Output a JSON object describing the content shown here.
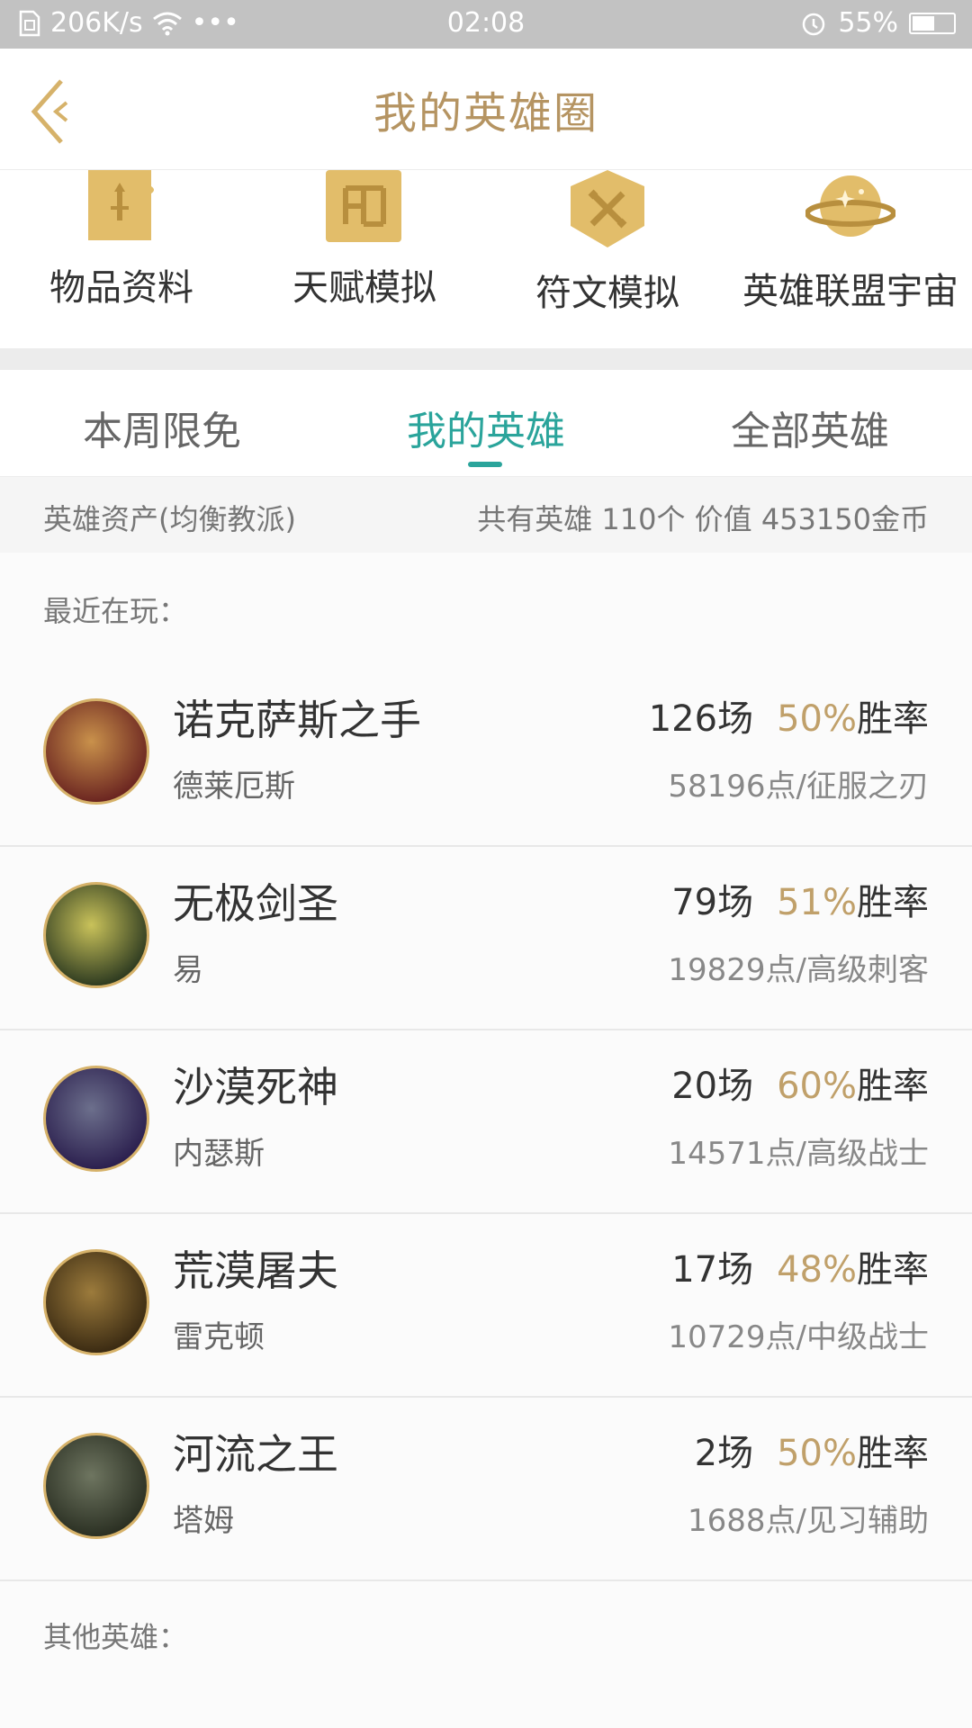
{
  "status": {
    "speed": "206K/s",
    "dots": "•••",
    "time": "02:08",
    "battery": "55%",
    "battery_level": 0.55
  },
  "header": {
    "title": "我的英雄圈"
  },
  "tools": [
    {
      "label": "物品资料",
      "icon": "sword-icon"
    },
    {
      "label": "天赋模拟",
      "icon": "talent-tree-icon"
    },
    {
      "label": "符文模拟",
      "icon": "rune-icon"
    },
    {
      "label": "英雄联盟宇宙",
      "icon": "planet-icon"
    }
  ],
  "tabs": [
    {
      "label": "本周限免"
    },
    {
      "label": "我的英雄",
      "active": true
    },
    {
      "label": "全部英雄"
    }
  ],
  "assets": {
    "left": "英雄资产(均衡教派)",
    "right": "共有英雄 110个  价值 453150金币"
  },
  "recent_label": "最近在玩：",
  "heroes": [
    {
      "title": "诺克萨斯之手",
      "name": "德莱厄斯",
      "games": "126场",
      "winrate": "50%",
      "winrate_suffix": "胜率",
      "points": "58196点/征服之刃",
      "color1": "#6a2420",
      "color2": "#c9914b"
    },
    {
      "title": "无极剑圣",
      "name": "易",
      "games": "79场",
      "winrate": "51%",
      "winrate_suffix": "胜率",
      "points": "19829点/高级刺客",
      "color1": "#2d3a20",
      "color2": "#c9c25a"
    },
    {
      "title": "沙漠死神",
      "name": "内瑟斯",
      "games": "20场",
      "winrate": "60%",
      "winrate_suffix": "胜率",
      "points": "14571点/高级战士",
      "color1": "#2b1f4e",
      "color2": "#6c6f8c"
    },
    {
      "title": "荒漠屠夫",
      "name": "雷克顿",
      "games": "17场",
      "winrate": "48%",
      "winrate_suffix": "胜率",
      "points": "10729点/中级战士",
      "color1": "#3a2a12",
      "color2": "#9c7b3c"
    },
    {
      "title": "河流之王",
      "name": "塔姆",
      "games": "2场",
      "winrate": "50%",
      "winrate_suffix": "胜率",
      "points": "1688点/见习辅助",
      "color1": "#2a2f22",
      "color2": "#6e7560"
    }
  ],
  "other_label": "其他英雄：",
  "colors": {
    "gold": "#b59462",
    "teal": "#2aa49b",
    "icon_gold": "#e2bd6a"
  }
}
